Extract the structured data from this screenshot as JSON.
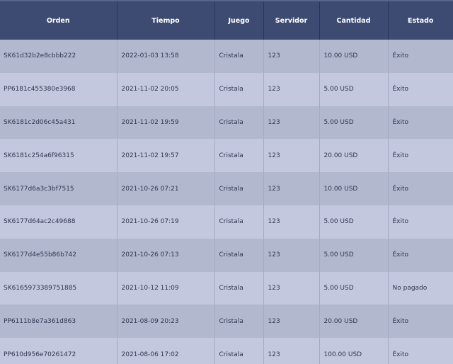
{
  "columns": [
    "Orden",
    "Tiempo",
    "Juego",
    "Servidor",
    "Cantidad",
    "Estado"
  ],
  "rows": [
    [
      "SK61d32b2e8cbbb222",
      "2022-01-03 13:58",
      "Cristala",
      "123",
      "10.00 USD",
      "Éxito"
    ],
    [
      "PP6181c455380e3968",
      "2021-11-02 20:05",
      "Cristala",
      "123",
      "5.00 USD",
      "Éxito"
    ],
    [
      "SK6181c2d06c45a431",
      "2021-11-02 19:59",
      "Cristala",
      "123",
      "5.00 USD",
      "Éxito"
    ],
    [
      "SK6181c254a6f96315",
      "2021-11-02 19:57",
      "Cristala",
      "123",
      "20.00 USD",
      "Éxito"
    ],
    [
      "SK6177d6a3c3bf7515",
      "2021-10-26 07:21",
      "Cristala",
      "123",
      "10.00 USD",
      "Éxito"
    ],
    [
      "SK6177d64ac2c49688",
      "2021-10-26 07:19",
      "Cristala",
      "123",
      "5.00 USD",
      "Éxito"
    ],
    [
      "SK6177d4e55b86b742",
      "2021-10-26 07:13",
      "Cristala",
      "123",
      "5.00 USD",
      "Éxito"
    ],
    [
      "SK6165973389751885",
      "2021-10-12 11:09",
      "Cristala",
      "123",
      "5.00 USD",
      "No pagado"
    ],
    [
      "PP6111b8e7a361d863",
      "2021-08-09 20:23",
      "Cristala",
      "123",
      "20.00 USD",
      "Éxito"
    ],
    [
      "PP610d956e70261472",
      "2021-08-06 17:02",
      "Cristala",
      "123",
      "100.00 USD",
      "Éxito"
    ]
  ]
}
